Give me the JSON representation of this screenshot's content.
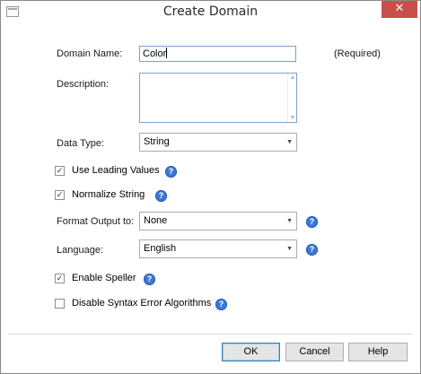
{
  "window": {
    "title": "Create Domain",
    "close_glyph": "✕"
  },
  "form": {
    "domain_name": {
      "label": "Domain Name:",
      "value": "Color",
      "hint": "(Required)"
    },
    "description": {
      "label": "Description:",
      "value": ""
    },
    "data_type": {
      "label": "Data Type:",
      "value": "String"
    },
    "use_leading_values": {
      "label": "Use Leading Values",
      "checked": true
    },
    "normalize_string": {
      "label": "Normalize String",
      "checked": true
    },
    "format_output": {
      "label": "Format Output to:",
      "value": "None"
    },
    "language": {
      "label": "Language:",
      "value": "English"
    },
    "enable_speller": {
      "label": "Enable Speller",
      "checked": true
    },
    "disable_syntax": {
      "label": "Disable Syntax Error Algorithms",
      "checked": false
    }
  },
  "glyphs": {
    "check": "✓",
    "dropdown": "▼",
    "scroll_up": "▲",
    "scroll_down": "▼",
    "help": "?"
  },
  "buttons": {
    "ok": "OK",
    "cancel": "Cancel",
    "help": "Help"
  },
  "icons": {
    "app": "window-icon",
    "close": "close-icon",
    "help": "help-icon",
    "dropdown": "chevron-down-icon"
  },
  "colors": {
    "accent": "#3b78d6",
    "close_button": "#c7504b",
    "input_border": "#7da2ce"
  }
}
